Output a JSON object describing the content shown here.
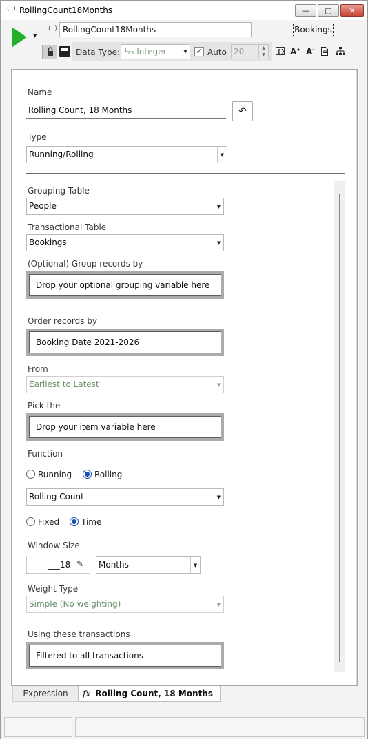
{
  "window": {
    "icon": "(..)",
    "title": "RollingCount18Months",
    "minimize_glyph": "—",
    "maximize_glyph": "▢",
    "close_glyph": "✕"
  },
  "toolbar": {
    "var_icon": "(..)",
    "variable_name": "RollingCount18Months",
    "table_tag": "Bookings",
    "data_type_label": "Data Type:",
    "data_type_value": "¹₂₃ Integer",
    "auto_label": "Auto",
    "auto_checked": "✓",
    "auto_value": "20",
    "icons": [
      "brace-icon",
      "font-increase-icon",
      "font-decrease-icon",
      "document-icon",
      "hierarchy-icon"
    ]
  },
  "form": {
    "name_label": "Name",
    "name_value": "Rolling Count, 18 Months",
    "undo_glyph": "↶",
    "type_label": "Type",
    "type_value": "Running/Rolling",
    "grouping_table_label": "Grouping Table",
    "grouping_table_value": "People",
    "transactional_table_label": "Transactional Table",
    "transactional_table_value": "Bookings",
    "group_by_label": "(Optional) Group records by",
    "group_by_drop": "Drop your optional grouping variable here",
    "order_by_label": "Order records by",
    "order_by_value": "Booking Date 2021-2026",
    "from_label": "From",
    "from_value": "Earliest to Latest",
    "pick_label": "Pick the",
    "pick_drop": "Drop your item variable here",
    "function_label": "Function",
    "function_options": [
      {
        "label": "Running",
        "selected": false
      },
      {
        "label": "Rolling",
        "selected": true
      }
    ],
    "function_value": "Rolling Count",
    "window_mode_options": [
      {
        "label": "Fixed",
        "selected": false
      },
      {
        "label": "Time",
        "selected": true
      }
    ],
    "window_size_label": "Window Size",
    "window_size_value": "___18",
    "window_unit_value": "Months",
    "weight_type_label": "Weight Type",
    "weight_type_value": "Simple (No weighting)",
    "transactions_label": "Using these transactions",
    "transactions_value": "Filtered to all transactions"
  },
  "tabs": {
    "expression_label": "Expression",
    "active_icon": "fx",
    "active_label": "Rolling Count, 18 Months"
  }
}
